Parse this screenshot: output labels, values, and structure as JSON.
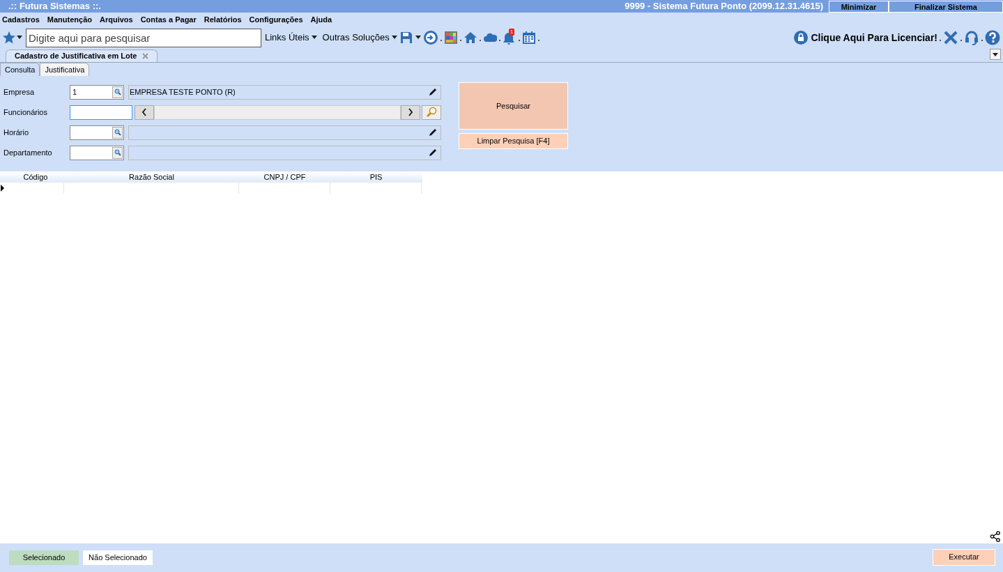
{
  "title_bar": {
    "app_name": ".:: Futura Sistemas ::.",
    "system_info": "9999 - Sistema Futura Ponto (2099.12.31.4615)",
    "buttons": [
      "Minimizar",
      "Finalizar Sistema"
    ]
  },
  "menu": [
    "Cadastros",
    "Manutenção",
    "Arquivos",
    "Contas a Pagar",
    "Relatórios",
    "Configurações",
    "Ajuda"
  ],
  "toolbar": {
    "search": {
      "placeholder": "Digite aqui para pesquisar"
    },
    "links": [
      "Links Úteis",
      "Outras Soluções"
    ],
    "notification_badge": "1",
    "license_link": "Clique Aqui Para Licenciar!"
  },
  "document_tab": {
    "title": "Cadastro de Justificativa em Lote"
  },
  "sub_tabs": [
    {
      "label": "Consulta",
      "selected": true
    },
    {
      "label": "Justificativa",
      "selected": false
    }
  ],
  "form": {
    "fields": [
      {
        "label": "Empresa",
        "kind": "lookup",
        "value": "1",
        "description": "EMPRESA TESTE PONTO (R)"
      },
      {
        "label": "Funcionários",
        "kind": "range"
      },
      {
        "label": "Horário",
        "kind": "lookup"
      },
      {
        "label": "Departamento",
        "kind": "lookup"
      }
    ],
    "search_button": "Pesquisar",
    "clear_button": "Limpar Pesquisa [F4]"
  },
  "table": {
    "columns": [
      "Código",
      "Razão Social",
      "CNPJ / CPF",
      "PIS"
    ]
  },
  "legend": [
    {
      "label": "Selecionado",
      "color": "#bddcc0"
    },
    {
      "label": "Não Selecionado",
      "color": "#ffffff"
    }
  ],
  "execute_button": "Executar"
}
